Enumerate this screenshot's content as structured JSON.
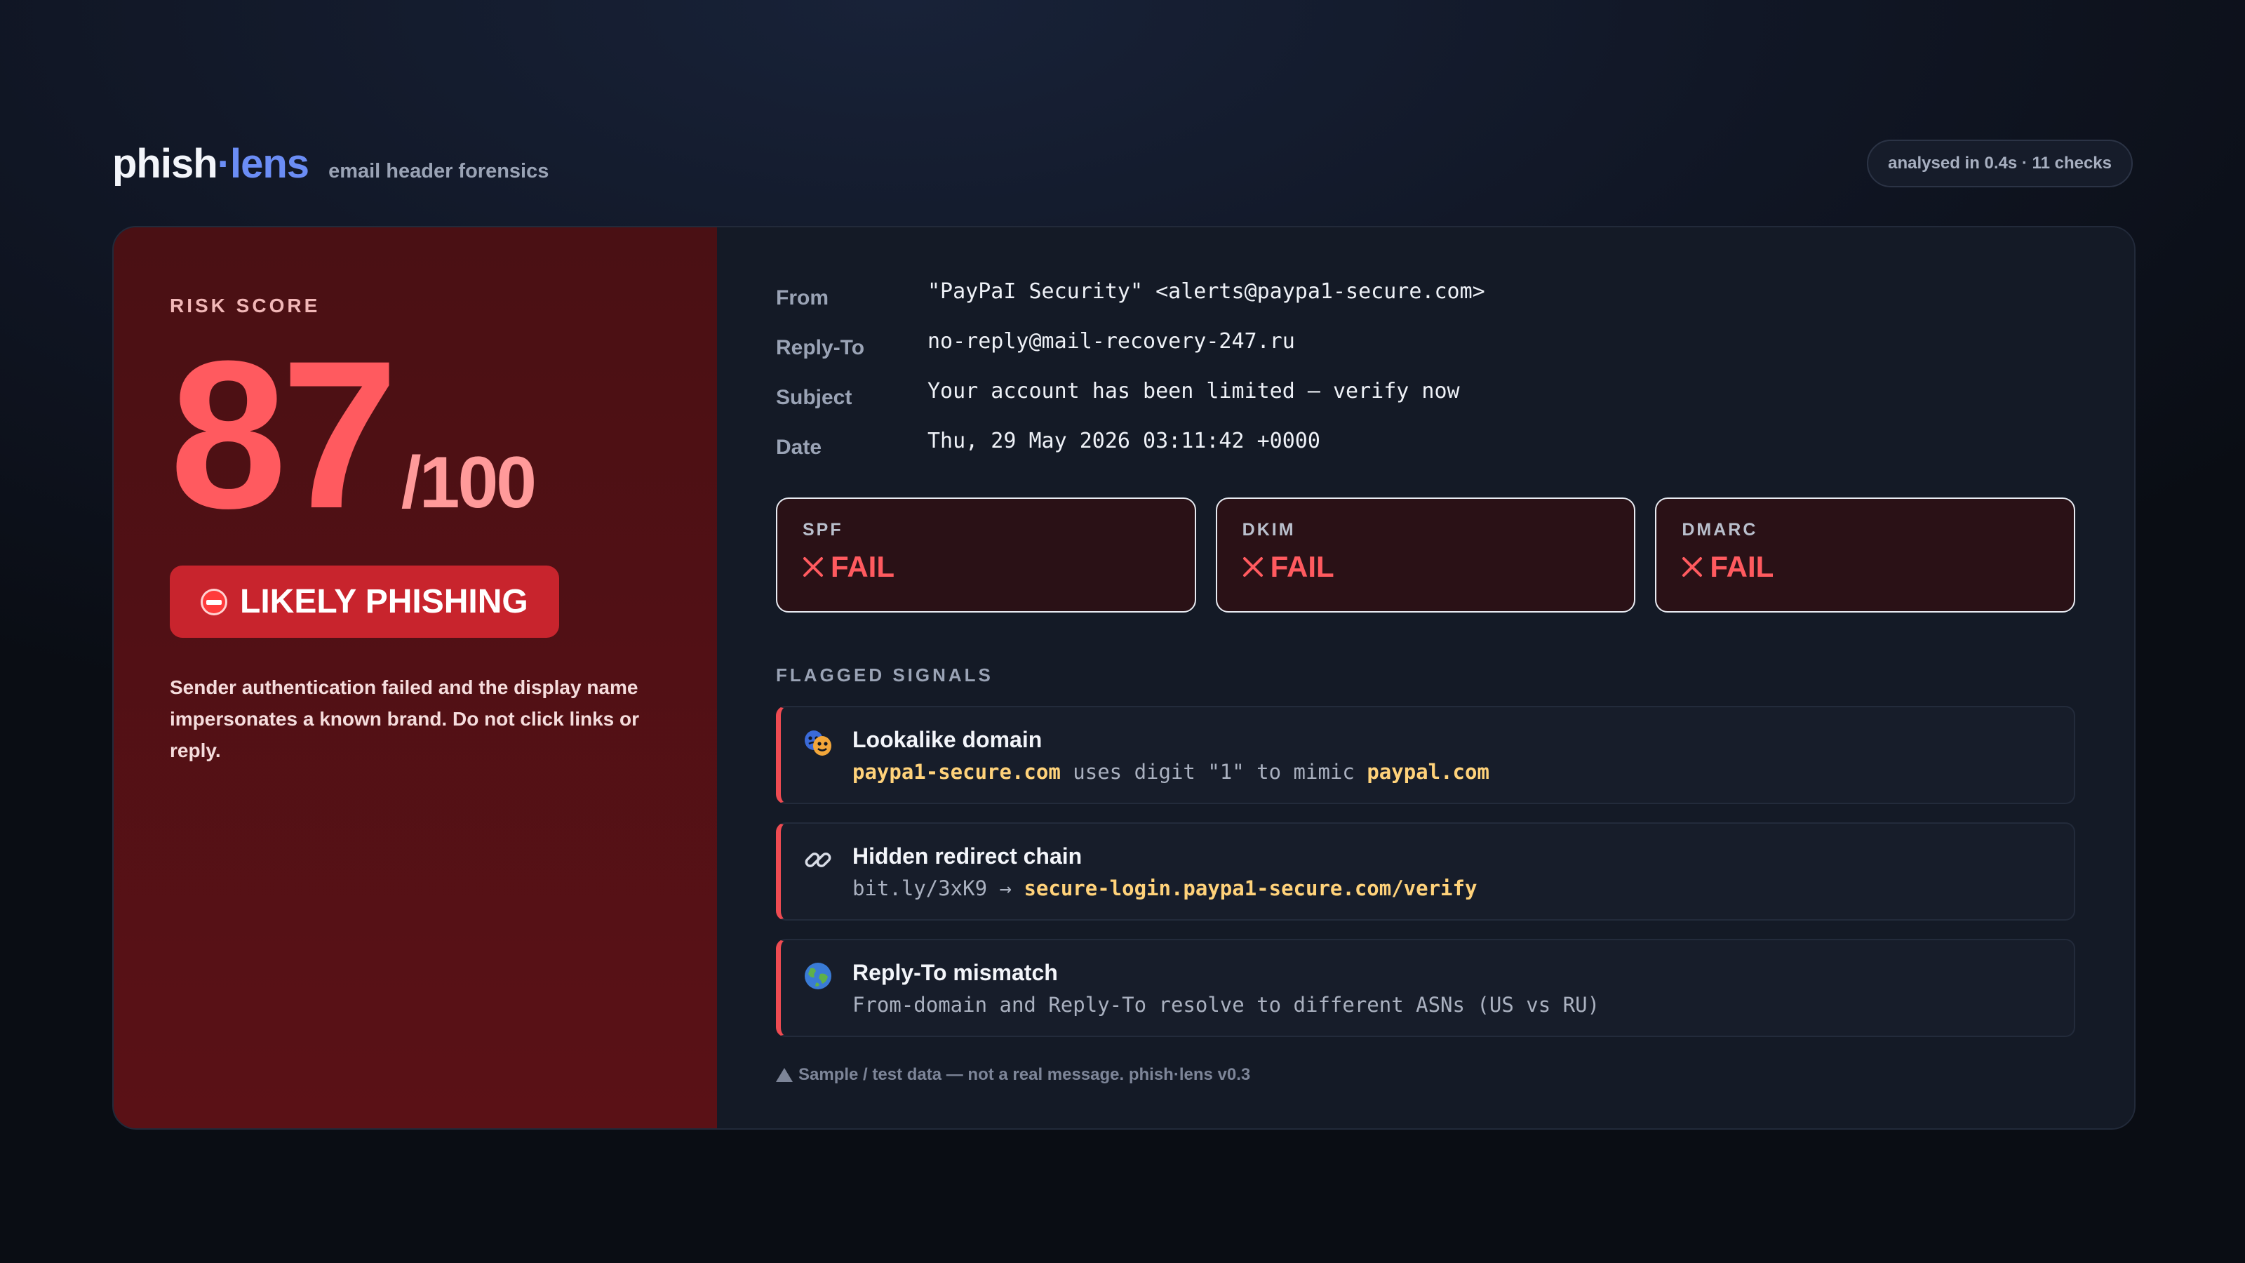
{
  "app": {
    "logo_part1": "phish",
    "logo_dot": "·",
    "logo_part2": "lens",
    "tagline": "email header forensics",
    "meta": "analysed in 0.4s · 11 checks"
  },
  "risk": {
    "label": "RISK SCORE",
    "score": "87",
    "max": "/100",
    "verdict": "LIKELY PHISHING",
    "summary": "Sender authentication failed and the display name impersonates a known brand. Do not click links or reply."
  },
  "headers": [
    {
      "key": "From",
      "value": "\"PayPaI Security\" <alerts@paypa1-secure.com>"
    },
    {
      "key": "Reply-To",
      "value": "no-reply@mail-recovery-247.ru"
    },
    {
      "key": "Subject",
      "value": "Your account has been limited — verify now"
    },
    {
      "key": "Date",
      "value": "Thu, 29 May 2026 03:11:42 +0000"
    }
  ],
  "auth": [
    {
      "label": "SPF",
      "status": "FAIL"
    },
    {
      "label": "DKIM",
      "status": "FAIL"
    },
    {
      "label": "DMARC",
      "status": "FAIL"
    }
  ],
  "signals_label": "FLAGGED SIGNALS",
  "signals": [
    {
      "icon": "mask-icon",
      "title": "Lookalike domain",
      "detail_a": "paypa1-secure.com",
      "detail_b": " uses digit \"1\" to mimic ",
      "detail_c": "paypal.com"
    },
    {
      "icon": "link-icon",
      "title": "Hidden redirect chain",
      "detail_a": "bit.ly/3xK9 → ",
      "detail_b": "secure-login.paypa1-secure.com/verify"
    },
    {
      "icon": "globe-icon",
      "title": "Reply-To mismatch",
      "detail_a": "From-domain and Reply-To resolve to different ASNs (US vs RU)"
    }
  ],
  "footnote": "Sample / test data — not a real message. phish·lens v0.3",
  "colors": {
    "accent": "#6b8df5",
    "danger": "#ff5a5f",
    "verdict_bg": "#c8242d",
    "highlight": "#ffd27a"
  }
}
